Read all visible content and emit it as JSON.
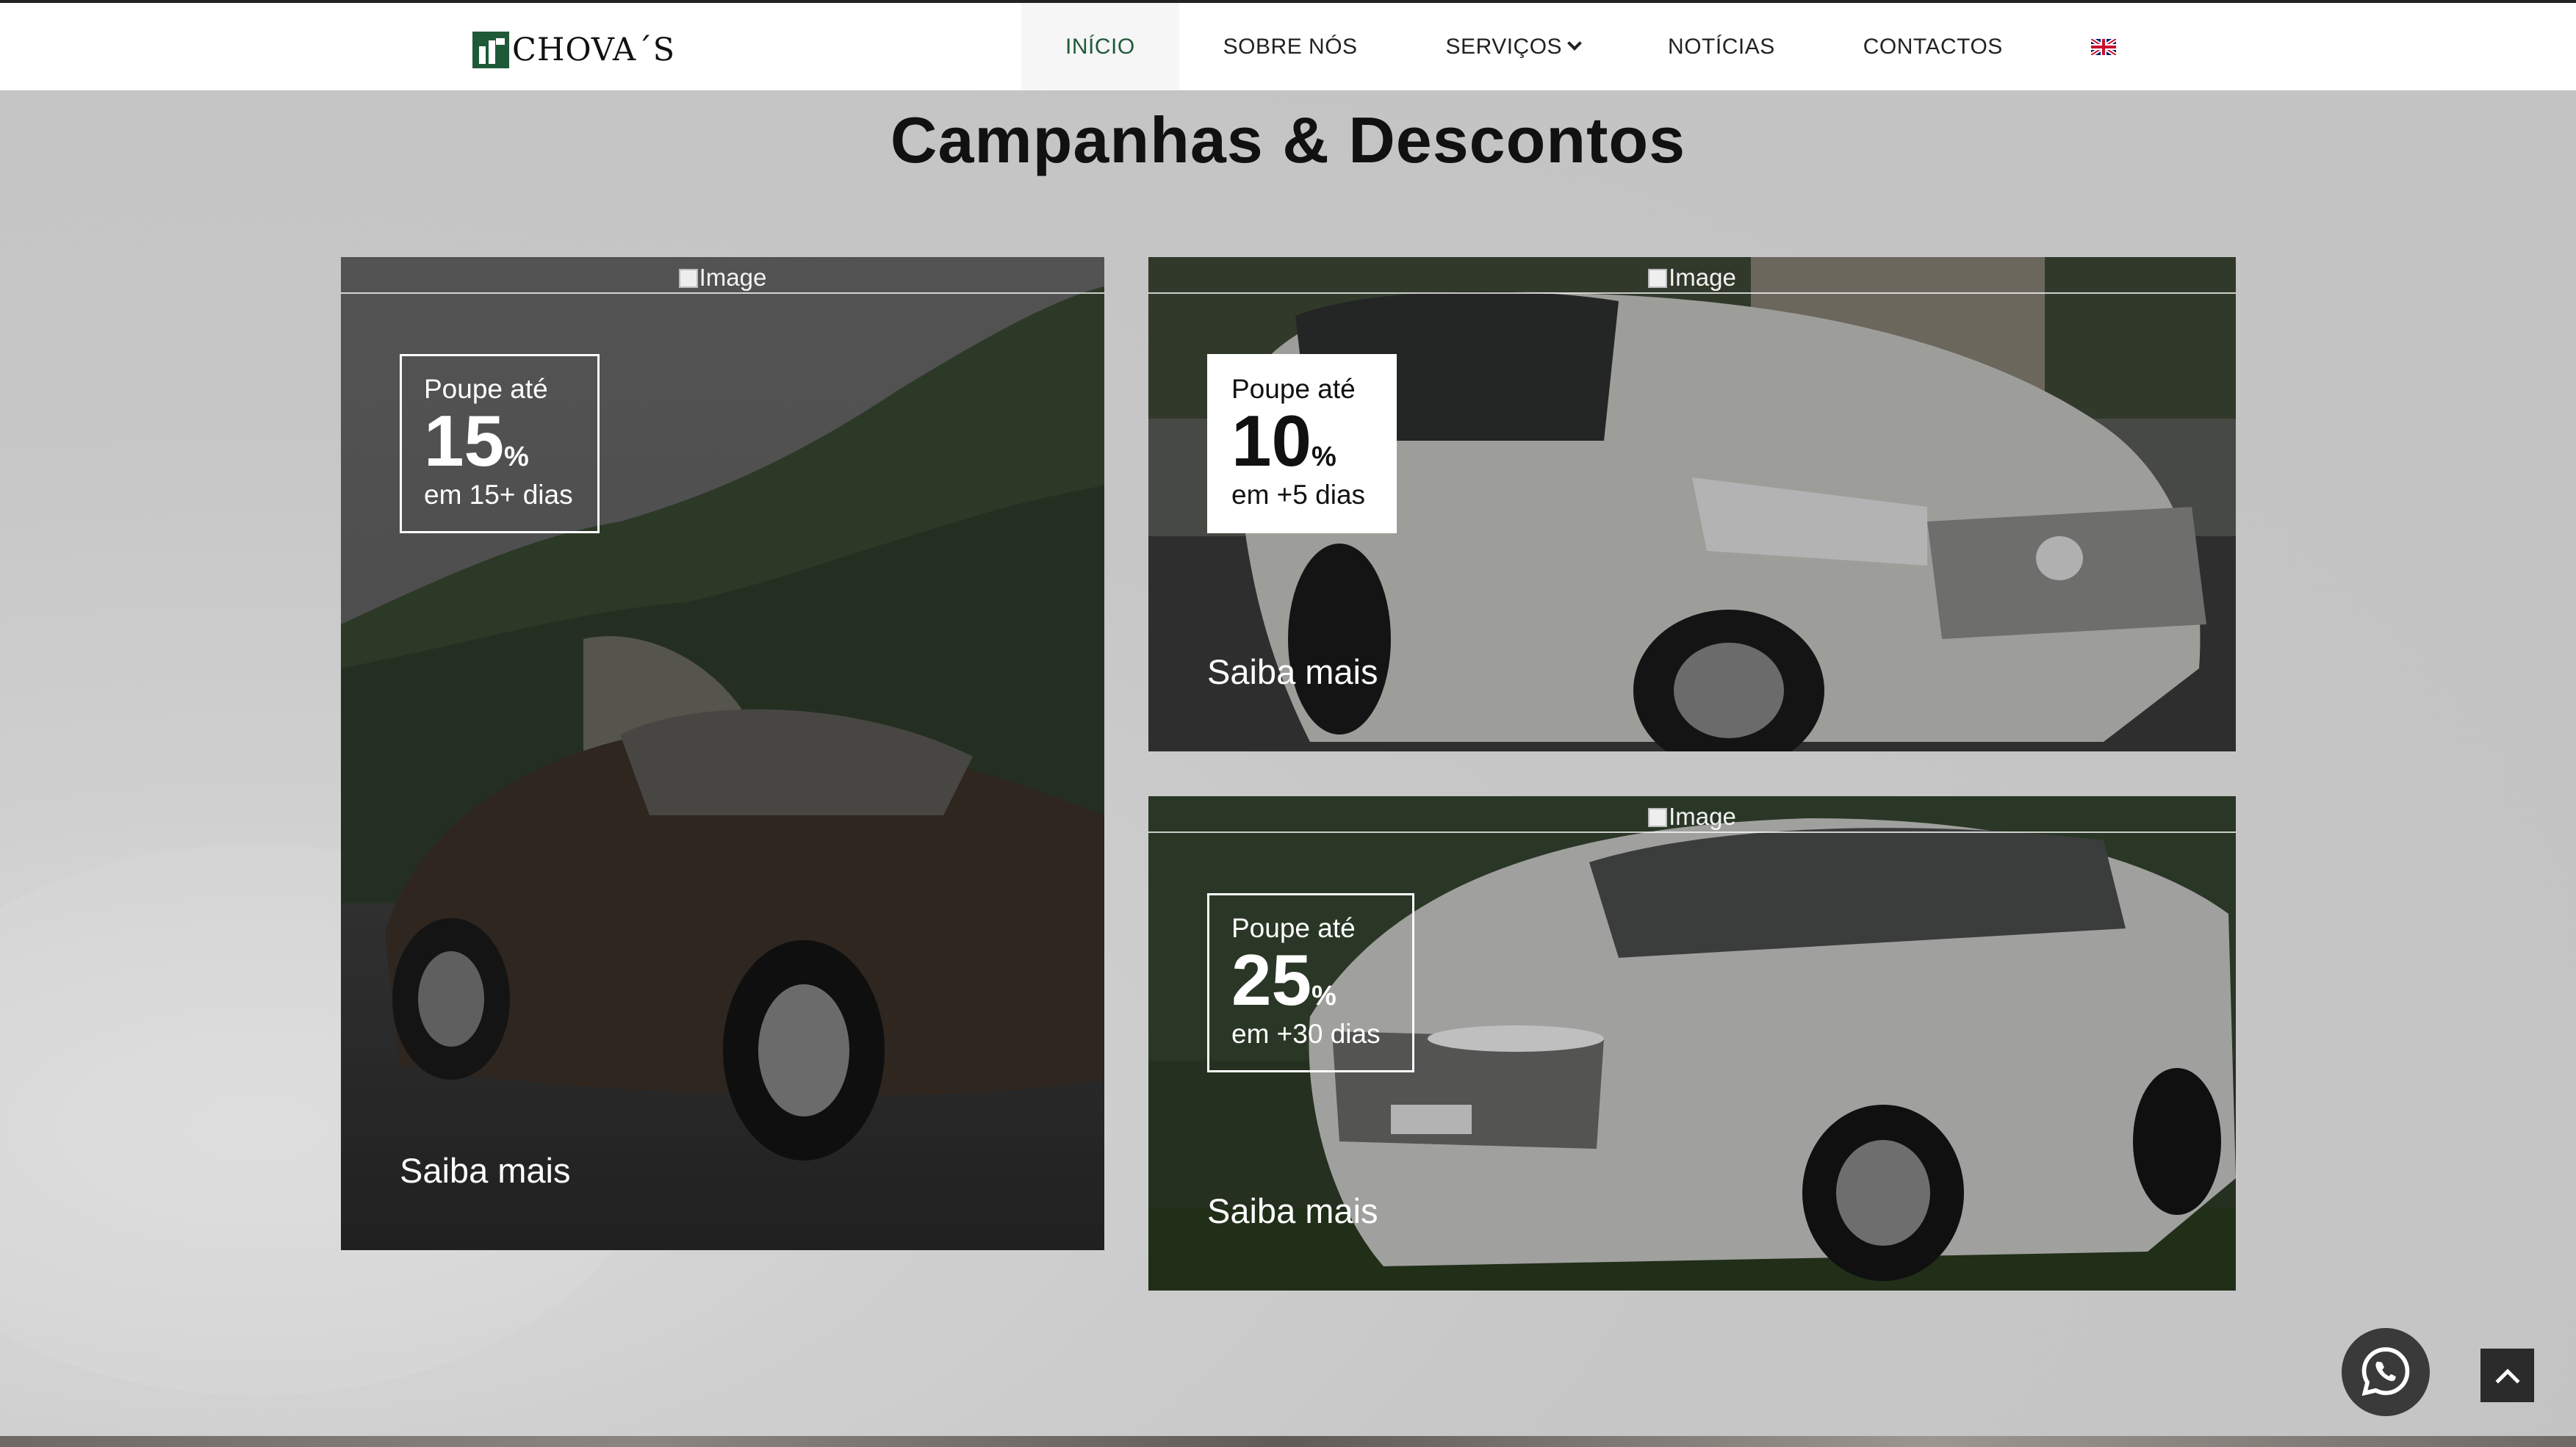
{
  "nav": {
    "logo_text": "CHOVA´S",
    "items": [
      {
        "label": "INÍCIO",
        "active": true
      },
      {
        "label": "SOBRE NÓS",
        "active": false
      },
      {
        "label": "SERVIÇOS",
        "active": false,
        "dropdown": true
      },
      {
        "label": "NOTÍCIAS",
        "active": false
      },
      {
        "label": "CONTACTOS",
        "active": false
      }
    ],
    "language_icon": "uk-flag-icon"
  },
  "section": {
    "title": "Campanhas & Descontos"
  },
  "cards": [
    {
      "image_alt": "Image",
      "pre": "Poupe até",
      "percent": "15",
      "unit": "%",
      "post": "em 15+ dias",
      "link": "Saiba mais",
      "style": "outline"
    },
    {
      "image_alt": "Image",
      "pre": "Poupe até",
      "percent": "10",
      "unit": "%",
      "post": "em +5 dias",
      "link": "Saiba mais",
      "style": "solid"
    },
    {
      "image_alt": "Image",
      "pre": "Poupe até",
      "percent": "25",
      "unit": "%",
      "post": "em +30 dias",
      "link": "Saiba mais",
      "style": "outline"
    }
  ],
  "floating": {
    "whatsapp_icon": "whatsapp-icon",
    "back_to_top_icon": "chevron-up-icon"
  }
}
